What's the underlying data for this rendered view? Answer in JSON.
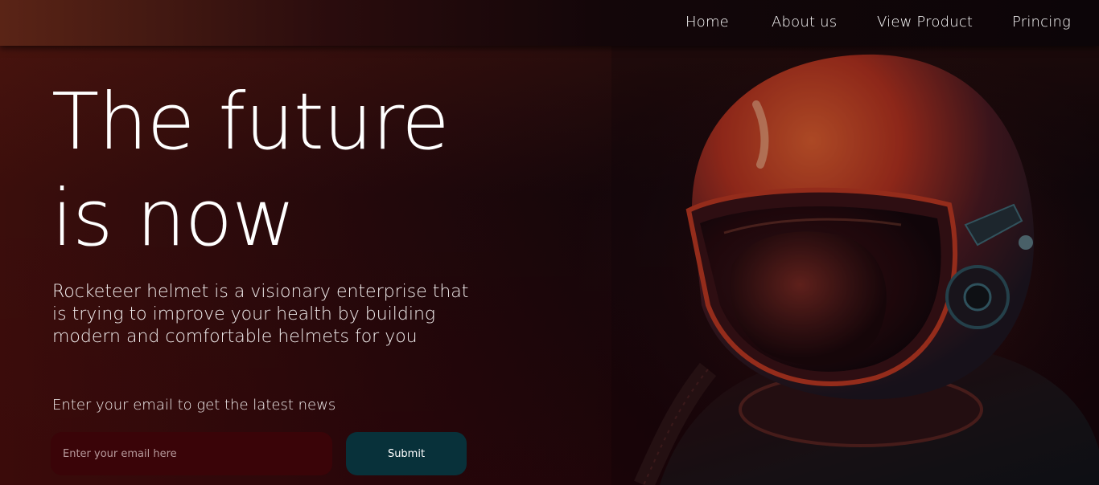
{
  "nav": {
    "items": [
      {
        "label": "Home"
      },
      {
        "label": "About us"
      },
      {
        "label": "View Product"
      },
      {
        "label": "Princing"
      }
    ]
  },
  "hero": {
    "title_line1": "The future",
    "title_line2": "is now",
    "description": "Rocketeer helmet is a visionary enterprise that is trying to improve your health by building modern and comfortable helmets for you"
  },
  "newsletter": {
    "label": "Enter your email to get the latest news",
    "placeholder": "Enter your email here",
    "submit_label": "Submit"
  },
  "colors": {
    "input_bg": "#3a0408",
    "button_bg": "#08313a",
    "text": "#ffffff"
  }
}
